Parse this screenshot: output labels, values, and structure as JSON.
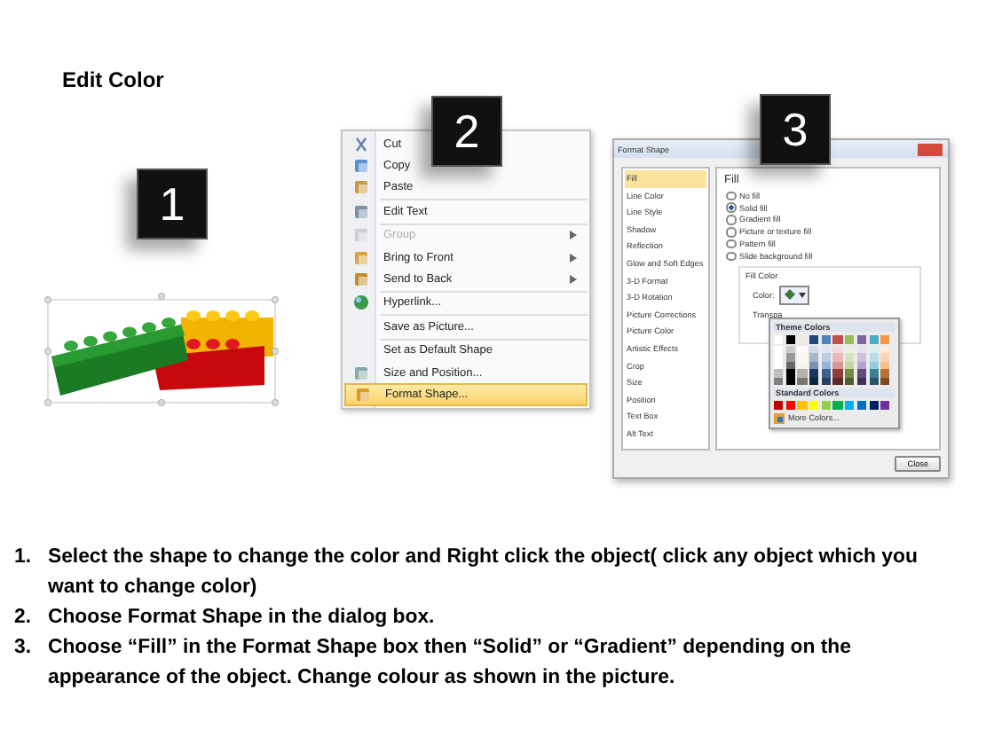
{
  "title": "Edit Color",
  "badges": [
    "1",
    "2",
    "3"
  ],
  "context_menu": {
    "items": [
      {
        "label": "Cut",
        "disabled": false,
        "selected": false,
        "submenu": false,
        "separator_before": false
      },
      {
        "label": "Copy",
        "disabled": false,
        "selected": false,
        "submenu": false,
        "separator_before": false
      },
      {
        "label": "Paste",
        "disabled": false,
        "selected": false,
        "submenu": false,
        "separator_before": false
      },
      {
        "label": "Edit Text",
        "disabled": false,
        "selected": false,
        "submenu": false,
        "separator_before": true
      },
      {
        "label": "Group",
        "disabled": true,
        "selected": false,
        "submenu": true,
        "separator_before": true
      },
      {
        "label": "Bring to Front",
        "disabled": false,
        "selected": false,
        "submenu": true,
        "separator_before": false
      },
      {
        "label": "Send to Back",
        "disabled": false,
        "selected": false,
        "submenu": true,
        "separator_before": false
      },
      {
        "label": "Hyperlink...",
        "disabled": false,
        "selected": false,
        "submenu": false,
        "separator_before": true
      },
      {
        "label": "Save as Picture...",
        "disabled": false,
        "selected": false,
        "submenu": false,
        "separator_before": true
      },
      {
        "label": "Set as Default Shape",
        "disabled": false,
        "selected": false,
        "submenu": false,
        "separator_before": true
      },
      {
        "label": "Size and Position...",
        "disabled": false,
        "selected": false,
        "submenu": false,
        "separator_before": false
      },
      {
        "label": "Format Shape...",
        "disabled": false,
        "selected": true,
        "submenu": false,
        "separator_before": false
      }
    ]
  },
  "dialog": {
    "title": "Format Shape",
    "categories": [
      {
        "label": "Fill",
        "selected": true
      },
      {
        "label": "Line Color",
        "selected": false
      },
      {
        "label": "Line Style",
        "selected": false
      },
      {
        "label": "Shadow",
        "selected": false
      },
      {
        "label": "Reflection",
        "selected": false
      },
      {
        "label": "Glow and Soft Edges",
        "selected": false
      },
      {
        "label": "3-D Format",
        "selected": false
      },
      {
        "label": "3-D Rotation",
        "selected": false
      },
      {
        "label": "Picture Corrections",
        "selected": false
      },
      {
        "label": "Picture Color",
        "selected": false
      },
      {
        "label": "Artistic Effects",
        "selected": false
      },
      {
        "label": "Crop",
        "selected": false
      },
      {
        "label": "Size",
        "selected": false
      },
      {
        "label": "Position",
        "selected": false
      },
      {
        "label": "Text Box",
        "selected": false
      },
      {
        "label": "Alt Text",
        "selected": false
      }
    ],
    "heading": "Fill",
    "options": [
      {
        "label": "No fill",
        "selected": false
      },
      {
        "label": "Solid fill",
        "selected": true
      },
      {
        "label": "Gradient fill",
        "selected": false
      },
      {
        "label": "Picture or texture fill",
        "selected": false
      },
      {
        "label": "Pattern fill",
        "selected": false
      },
      {
        "label": "Slide background fill",
        "selected": false
      }
    ],
    "group_label": "Fill Color",
    "color_label": "Color:",
    "transparency_label": "Transpa",
    "palette": {
      "theme_heading": "Theme Colors",
      "theme": [
        {
          "color": "#ffffff"
        },
        {
          "color": "#000000"
        },
        {
          "color": "#eeece1"
        },
        {
          "color": "#1f497d"
        },
        {
          "color": "#4f81bd"
        },
        {
          "color": "#c0504d"
        },
        {
          "color": "#9bbb59"
        },
        {
          "color": "#8064a2"
        },
        {
          "color": "#4bacc6"
        },
        {
          "color": "#f79646"
        }
      ],
      "standard_heading": "Standard Colors",
      "standard": [
        {
          "color": "#c00000"
        },
        {
          "color": "#ff0000"
        },
        {
          "color": "#ffc000"
        },
        {
          "color": "#ffff00"
        },
        {
          "color": "#92d050"
        },
        {
          "color": "#00b050"
        },
        {
          "color": "#00b0f0"
        },
        {
          "color": "#0070c0"
        },
        {
          "color": "#002060"
        },
        {
          "color": "#7030a0"
        }
      ],
      "more": "More Colors..."
    },
    "close_button": "Close"
  },
  "instructions": [
    {
      "number": "1.",
      "text": "Select the shape to change the color and Right click the object( click any object which you want to change color)"
    },
    {
      "number": "2.",
      "text": "Choose Format Shape in the dialog box."
    },
    {
      "number": "3.",
      "text": "Choose “Fill” in the Format Shape box then “Solid” or “Gradient” depending on the appearance of the object. Change colour as shown in the picture."
    }
  ]
}
